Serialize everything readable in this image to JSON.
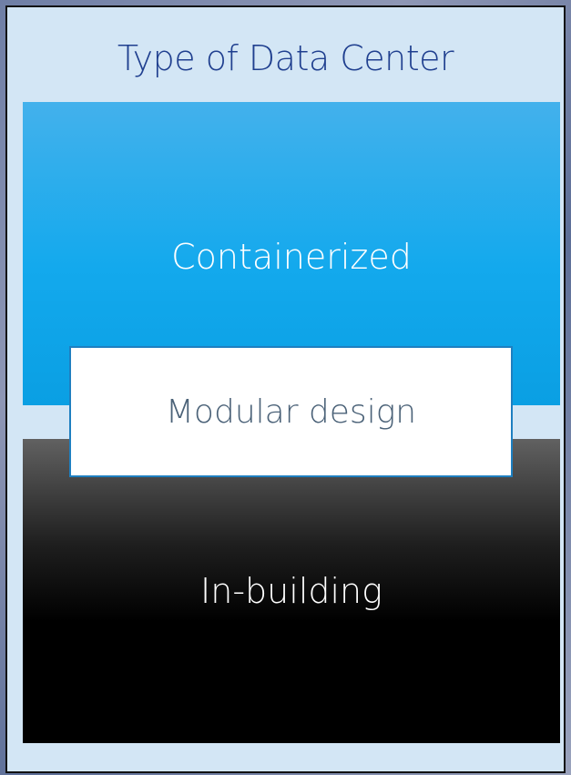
{
  "diagram": {
    "title": "Type of Data Center",
    "top_block": {
      "label": "Containerized",
      "color": "#13a9ed"
    },
    "middle_block": {
      "label": "Modular design",
      "color": "#ffffff",
      "border_color": "#1e7fc0"
    },
    "bottom_block": {
      "label": "In-building",
      "color": "#000000"
    },
    "panel_color": "#d3e6f5",
    "title_color": "#1f3f8f"
  }
}
